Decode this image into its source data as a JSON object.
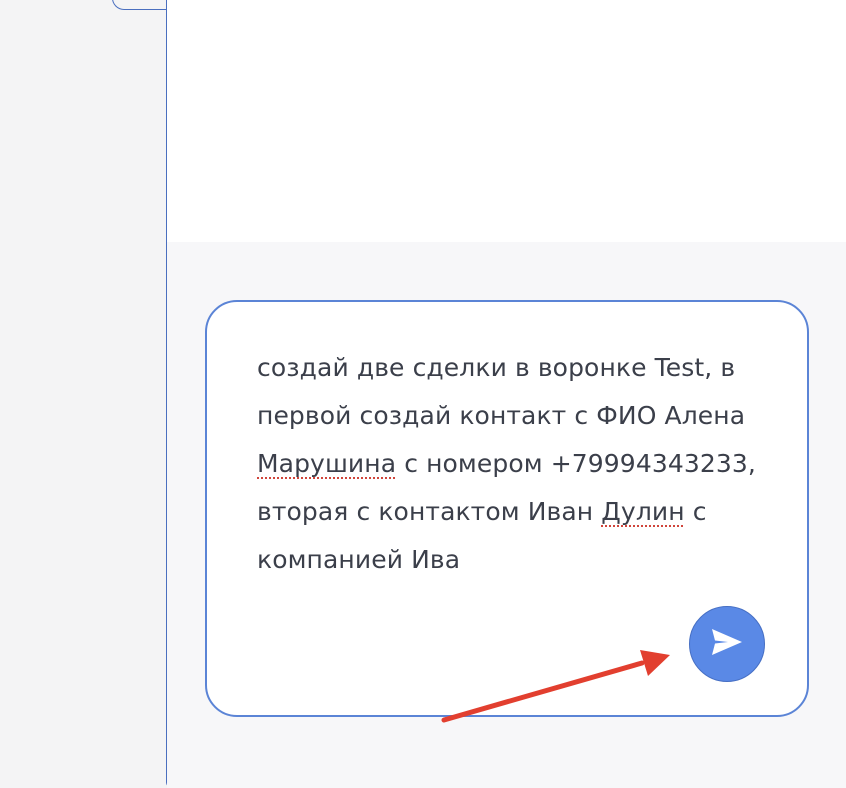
{
  "composer": {
    "message_parts": [
      "создай две сделки в воронке Test, в первой создай контакт с ФИО Алена ",
      "Марушина",
      " с номером +79994343233, вторая с контактом Иван ",
      "Дулин",
      " с компанией Ива"
    ]
  },
  "icons": {
    "send": "send-icon",
    "annotation": "red-arrow-annotation"
  },
  "colors": {
    "border_accent": "#5b84d6",
    "send_button": "#5a89e6",
    "annotation": "#e23f2f"
  }
}
